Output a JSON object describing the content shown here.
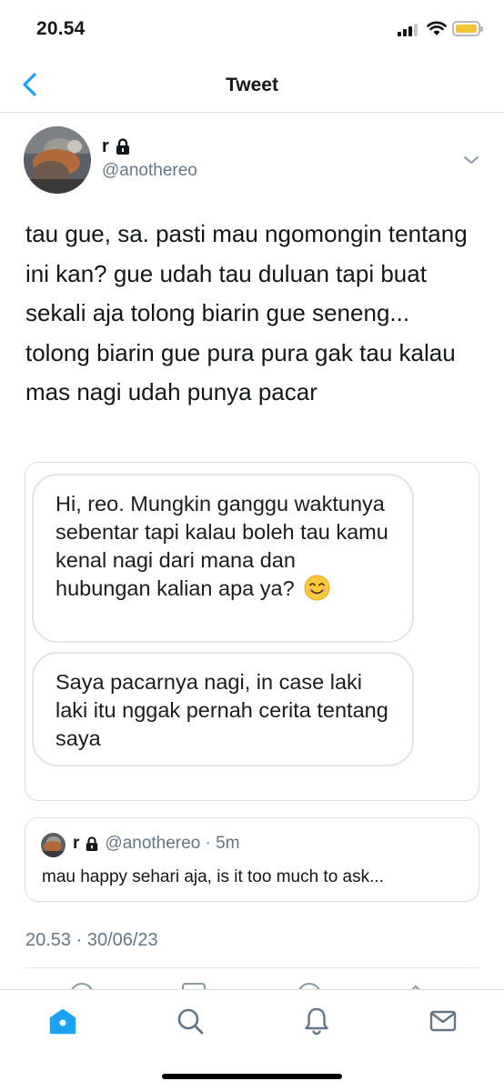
{
  "status_bar": {
    "time": "20.54",
    "battery_color": "#f2c335"
  },
  "nav": {
    "title": "Tweet",
    "back_icon": "chevron-left-icon",
    "accent_color": "#1da1f2"
  },
  "tweet": {
    "author_name": "r",
    "author_handle": "@anothereo",
    "protected_icon": "lock-icon",
    "text": "tau gue, sa. pasti mau ngomongin tentang ini kan? gue udah tau duluan tapi buat sekali aja tolong biarin gue seneng... tolong biarin gue pura pura gak tau kalau mas nagi udah punya pacar",
    "timestamp": "20.53 · 30/06/23"
  },
  "image": {
    "bubbles": [
      {
        "text": "Hi, reo. Mungkin ganggu waktunya sebentar tapi kalau boleh tau kamu kenal nagi dari mana dan hubungan kalian apa ya?",
        "emoji": "smiling-face-icon"
      },
      {
        "text": "Saya pacarnya nagi, in case laki laki itu nggak pernah cerita tentang saya"
      }
    ]
  },
  "quote": {
    "author_name": "r",
    "handle_time": "@anothereo · 5m",
    "text": "mau happy sehari aja, is it too much to ask..."
  },
  "tab_bar": {
    "tabs": [
      {
        "name": "home",
        "icon": "home-icon",
        "active": true
      },
      {
        "name": "search",
        "icon": "search-icon",
        "active": false
      },
      {
        "name": "notifications",
        "icon": "bell-icon",
        "active": false
      },
      {
        "name": "messages",
        "icon": "mail-icon",
        "active": false
      }
    ]
  }
}
